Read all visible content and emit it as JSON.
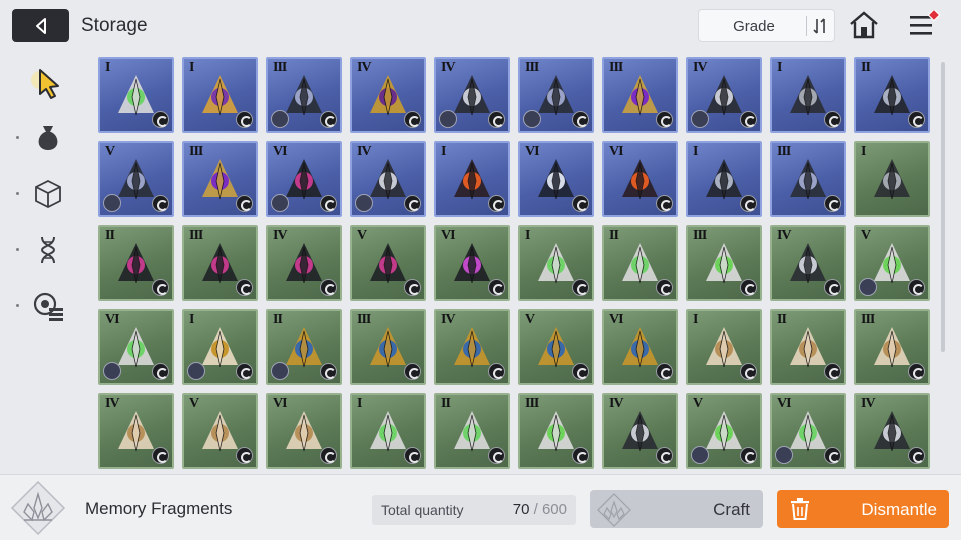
{
  "header": {
    "title": "Storage",
    "sort_label": "Grade",
    "icons": [
      "back-arrow-icon",
      "sort-toggle-icon",
      "home-icon",
      "menu-icon",
      "notification-dot-icon"
    ]
  },
  "sidebar": {
    "items": [
      {
        "name": "all-items",
        "icon": "cursor-pointer-icon",
        "selected": true
      },
      {
        "name": "bag",
        "icon": "bag-icon",
        "selected": false
      },
      {
        "name": "materials",
        "icon": "cube-icon",
        "selected": false
      },
      {
        "name": "gene",
        "icon": "dna-icon",
        "selected": false
      },
      {
        "name": "memory-fragments",
        "icon": "disc-list-icon",
        "selected": false
      }
    ]
  },
  "grid": {
    "rows": [
      [
        {
          "tier": "I",
          "rarity": "blue",
          "kind": "syringe",
          "badge": "wave"
        },
        {
          "tier": "I",
          "rarity": "blue",
          "kind": "sword",
          "badge": "gear"
        },
        {
          "tier": "III",
          "rarity": "blue",
          "kind": "orb",
          "badge": "wave",
          "equipped": true
        },
        {
          "tier": "IV",
          "rarity": "blue",
          "kind": "amulet",
          "badge": "gear"
        },
        {
          "tier": "IV",
          "rarity": "blue",
          "kind": "chain",
          "badge": "wave",
          "equipped": true
        },
        {
          "tier": "III",
          "rarity": "blue",
          "kind": "orb",
          "badge": "wave",
          "equipped": true
        },
        {
          "tier": "III",
          "rarity": "blue",
          "kind": "gem",
          "badge": "gear"
        },
        {
          "tier": "IV",
          "rarity": "blue",
          "kind": "chain",
          "badge": "wave",
          "equipped": true
        },
        {
          "tier": "I",
          "rarity": "blue",
          "kind": "blade",
          "badge": "wave"
        },
        {
          "tier": "II",
          "rarity": "blue",
          "kind": "claw",
          "badge": "wave"
        }
      ],
      [
        {
          "tier": "V",
          "rarity": "blue",
          "kind": "orb",
          "badge": "wave",
          "equipped": true
        },
        {
          "tier": "III",
          "rarity": "blue",
          "kind": "gem",
          "badge": "gear"
        },
        {
          "tier": "VI",
          "rarity": "blue",
          "kind": "wing",
          "badge": "wave",
          "equipped": true
        },
        {
          "tier": "IV",
          "rarity": "blue",
          "kind": "chain",
          "badge": "wave",
          "equipped": true
        },
        {
          "tier": "I",
          "rarity": "blue",
          "kind": "flame",
          "badge": "fire"
        },
        {
          "tier": "VI",
          "rarity": "blue",
          "kind": "crystal",
          "badge": "snow"
        },
        {
          "tier": "VI",
          "rarity": "blue",
          "kind": "flame",
          "badge": "fire"
        },
        {
          "tier": "I",
          "rarity": "blue",
          "kind": "claw",
          "badge": "snow"
        },
        {
          "tier": "III",
          "rarity": "blue",
          "kind": "orb",
          "badge": "snow"
        },
        {
          "tier": "I",
          "rarity": "green",
          "kind": "blade",
          "badge": "none"
        }
      ],
      [
        {
          "tier": "II",
          "rarity": "green",
          "kind": "wing",
          "badge": "claw"
        },
        {
          "tier": "III",
          "rarity": "green",
          "kind": "wing",
          "badge": "claw"
        },
        {
          "tier": "IV",
          "rarity": "green",
          "kind": "wing",
          "badge": "claw"
        },
        {
          "tier": "V",
          "rarity": "green",
          "kind": "wing",
          "badge": "claw"
        },
        {
          "tier": "VI",
          "rarity": "green",
          "kind": "feather",
          "badge": "claw"
        },
        {
          "tier": "I",
          "rarity": "green",
          "kind": "syringe",
          "badge": "wave"
        },
        {
          "tier": "II",
          "rarity": "green",
          "kind": "syringe",
          "badge": "wave"
        },
        {
          "tier": "III",
          "rarity": "green",
          "kind": "flask",
          "badge": "wave"
        },
        {
          "tier": "IV",
          "rarity": "green",
          "kind": "chain",
          "badge": "wave"
        },
        {
          "tier": "V",
          "rarity": "green",
          "kind": "flask",
          "badge": "wave",
          "equipped": true
        }
      ],
      [
        {
          "tier": "VI",
          "rarity": "green",
          "kind": "syringe",
          "badge": "wave",
          "equipped": true
        },
        {
          "tier": "I",
          "rarity": "green",
          "kind": "shield",
          "badge": "trident",
          "equipped": true
        },
        {
          "tier": "II",
          "rarity": "green",
          "kind": "staff",
          "badge": "trident",
          "equipped": true
        },
        {
          "tier": "III",
          "rarity": "green",
          "kind": "trident",
          "badge": "trident"
        },
        {
          "tier": "IV",
          "rarity": "green",
          "kind": "trident",
          "badge": "trident"
        },
        {
          "tier": "V",
          "rarity": "green",
          "kind": "trident",
          "badge": "trident"
        },
        {
          "tier": "VI",
          "rarity": "green",
          "kind": "trident",
          "badge": "trident"
        },
        {
          "tier": "I",
          "rarity": "green",
          "kind": "leaf",
          "badge": "swirl"
        },
        {
          "tier": "II",
          "rarity": "green",
          "kind": "leaf",
          "badge": "swirl"
        },
        {
          "tier": "III",
          "rarity": "green",
          "kind": "leaf",
          "badge": "swirl"
        }
      ],
      [
        {
          "tier": "IV",
          "rarity": "green",
          "kind": "leaf",
          "badge": "swirl"
        },
        {
          "tier": "V",
          "rarity": "green",
          "kind": "leaf",
          "badge": "swirl"
        },
        {
          "tier": "VI",
          "rarity": "green",
          "kind": "leaf",
          "badge": "swirl"
        },
        {
          "tier": "I",
          "rarity": "green",
          "kind": "syringe",
          "badge": "wave"
        },
        {
          "tier": "II",
          "rarity": "green",
          "kind": "syringe",
          "badge": "wave"
        },
        {
          "tier": "III",
          "rarity": "green",
          "kind": "flask",
          "badge": "wave"
        },
        {
          "tier": "IV",
          "rarity": "green",
          "kind": "chain",
          "badge": "wave"
        },
        {
          "tier": "V",
          "rarity": "green",
          "kind": "flask",
          "badge": "wave",
          "equipped": true
        },
        {
          "tier": "VI",
          "rarity": "green",
          "kind": "syringe",
          "badge": "wave",
          "equipped": true
        },
        {
          "tier": "IV",
          "rarity": "green",
          "kind": "chain",
          "badge": "wave"
        }
      ]
    ]
  },
  "footer": {
    "category_label": "Memory Fragments",
    "quantity_label": "Total quantity",
    "quantity_current": "70",
    "quantity_sep": " / ",
    "quantity_max": "600",
    "craft_label": "Craft",
    "dismantle_label": "Dismantle"
  },
  "colors": {
    "accent_orange": "#f27d22",
    "blue_tile": "#4b5fa8",
    "green_tile": "#5c7a56",
    "notification_red": "#e0303a",
    "selected_cursor": "#f2c230"
  }
}
